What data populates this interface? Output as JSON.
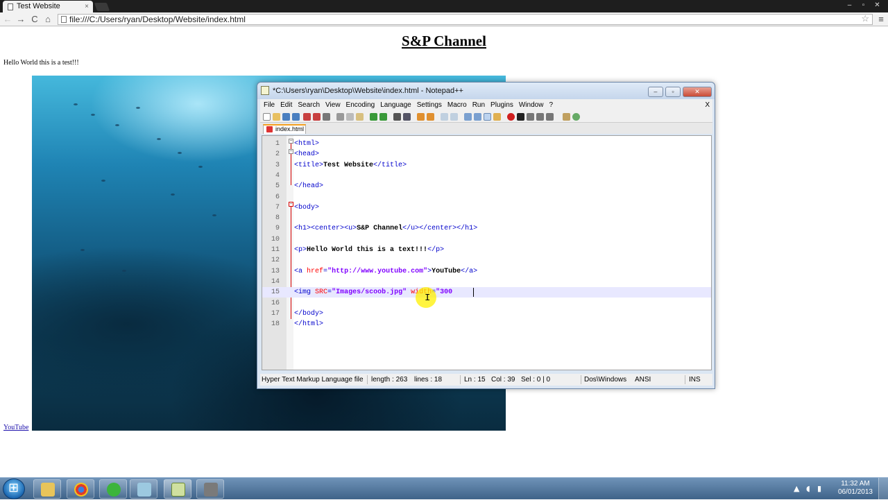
{
  "browser": {
    "tab_title": "Test Website",
    "tab_close": "×",
    "address": "file:///C:/Users/ryan/Desktop/Website/index.html",
    "nav": {
      "back": "←",
      "forward": "→",
      "reload": "C",
      "home": "⌂"
    },
    "star": "☆",
    "menu": "≡",
    "window_buttons": {
      "minimize": "–",
      "maximize": "▫",
      "close": "✕"
    }
  },
  "page": {
    "heading": "S&P Channel",
    "paragraph": "Hello World this is a test!!!",
    "link": "YouTube"
  },
  "notepad": {
    "title": "*C:\\Users\\ryan\\Desktop\\Website\\index.html - Notepad++",
    "menu": [
      "File",
      "Edit",
      "Search",
      "View",
      "Encoding",
      "Language",
      "Settings",
      "Macro",
      "Run",
      "Plugins",
      "Window",
      "?"
    ],
    "menu_close": "X",
    "tab": "index.html",
    "lines": [
      {
        "n": "1",
        "code": "<html>"
      },
      {
        "n": "2",
        "code": "<head>"
      },
      {
        "n": "3",
        "code": "<title>Test Website</title>"
      },
      {
        "n": "4",
        "code": ""
      },
      {
        "n": "5",
        "code": "</head>"
      },
      {
        "n": "6",
        "code": ""
      },
      {
        "n": "7",
        "code": "<body>"
      },
      {
        "n": "8",
        "code": ""
      },
      {
        "n": "9",
        "code": "<h1><center><u>S&P Channel</u></center></h1>"
      },
      {
        "n": "10",
        "code": ""
      },
      {
        "n": "11",
        "code": "<p>Hello World this is a text!!!</p>"
      },
      {
        "n": "12",
        "code": ""
      },
      {
        "n": "13",
        "code": "<a href=\"http://www.youtube.com\">YouTube</a>"
      },
      {
        "n": "14",
        "code": ""
      },
      {
        "n": "15",
        "code": "<img SRC=\"Images/scoob.jpg\" width=\"300"
      },
      {
        "n": "16",
        "code": ""
      },
      {
        "n": "17",
        "code": "</body>"
      },
      {
        "n": "18",
        "code": "</html>"
      }
    ],
    "status": {
      "filetype": "Hyper Text Markup Language file",
      "length": "length : 263",
      "lines": "lines : 18",
      "ln": "Ln : 15",
      "col": "Col : 39",
      "sel": "Sel : 0 | 0",
      "eol": "Dos\\Windows",
      "encoding": "ANSI",
      "mode": "INS"
    }
  },
  "taskbar": {
    "time": "11:32 AM",
    "date": "06/01/2013",
    "apps": [
      "explorer",
      "chrome",
      "spotify",
      "app4",
      "notepad++",
      "app6"
    ]
  },
  "colors": {
    "tag": "#0000cc",
    "attr": "#ff0000",
    "string": "#8000ff",
    "link": "#1a0dab"
  }
}
